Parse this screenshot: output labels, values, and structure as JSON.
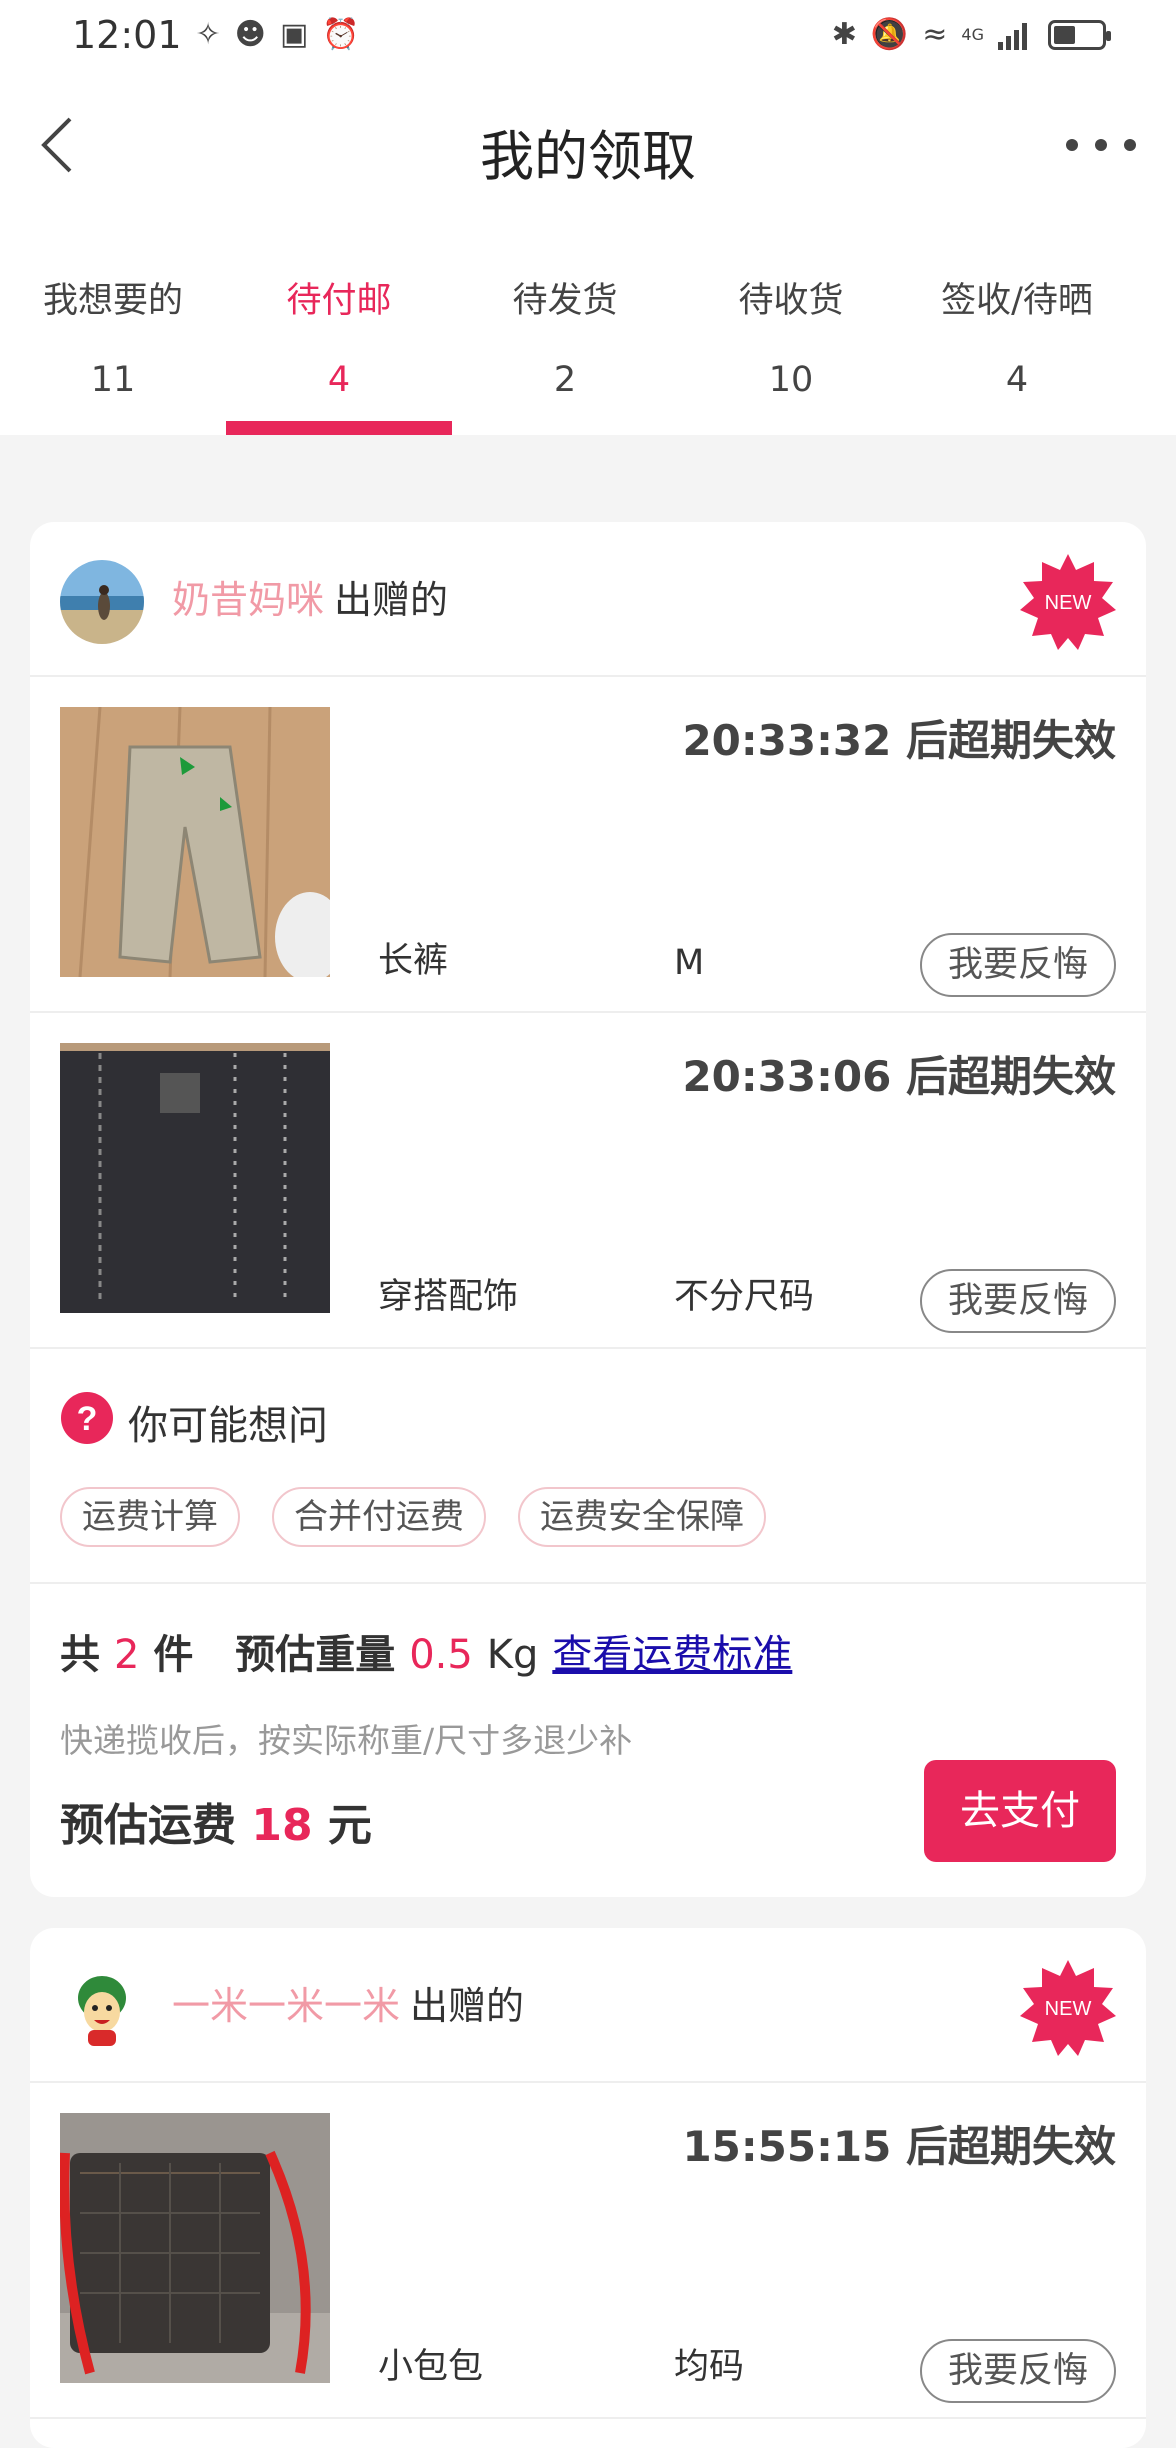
{
  "status_bar": {
    "time": "12:01",
    "network": "4G"
  },
  "header": {
    "title": "我的领取"
  },
  "tabs": [
    {
      "label": "我想要的",
      "count": "11"
    },
    {
      "label": "待付邮",
      "count": "4"
    },
    {
      "label": "待发货",
      "count": "2"
    },
    {
      "label": "待收货",
      "count": "10"
    },
    {
      "label": "签收/待晒",
      "count": "4"
    }
  ],
  "active_tab_index": 1,
  "colors": {
    "accent": "#e8275a",
    "giver_name": "#f19aa6",
    "link": "#1a0dab"
  },
  "cards": [
    {
      "giver_name": "奶昔妈咪",
      "giver_suffix": "出赠的",
      "badge": "NEW",
      "items": [
        {
          "expire": "20:33:32 后超期失效",
          "name": "长裤",
          "size": "M",
          "action": "我要反悔"
        },
        {
          "expire": "20:33:06 后超期失效",
          "name": "穿搭配饰",
          "size": "不分尺码",
          "action": "我要反悔"
        }
      ],
      "faq": {
        "title": "你可能想问",
        "chips": [
          "运费计算",
          "合并付运费",
          "运费安全保障"
        ]
      },
      "summary": {
        "total_prefix": "共",
        "total_count": "2",
        "total_unit": "件",
        "weight_label": "预估重量",
        "weight_value": "0.5",
        "weight_unit": "Kg",
        "link": "查看运费标准",
        "note": "快递揽收后，按实际称重/尺寸多退少补",
        "fee_label": "预估运费",
        "fee_value": "18",
        "fee_unit": "元",
        "pay_button": "去支付"
      }
    },
    {
      "giver_name": "一米一米一米",
      "giver_suffix": "出赠的",
      "badge": "NEW",
      "items": [
        {
          "expire": "15:55:15 后超期失效",
          "name": "小包包",
          "size": "均码",
          "action": "我要反悔"
        }
      ]
    }
  ]
}
